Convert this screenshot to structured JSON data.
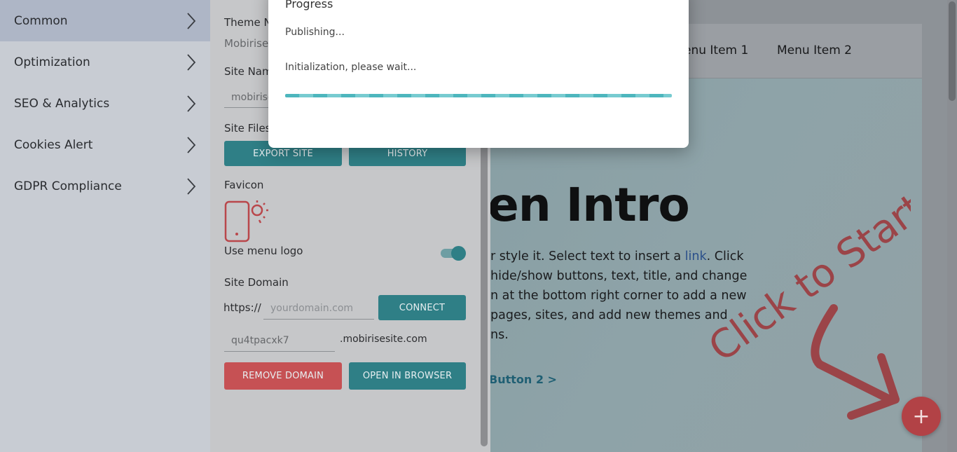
{
  "sidebar": {
    "items": [
      {
        "label": "Common",
        "active": true
      },
      {
        "label": "Optimization"
      },
      {
        "label": "SEO & Analytics"
      },
      {
        "label": "Cookies Alert"
      },
      {
        "label": "GDPR Compliance"
      }
    ]
  },
  "panel": {
    "theme_name_label": "Theme N",
    "theme_name_value": "Mobirise",
    "site_name_label": "Site Nam",
    "site_name_value": "mobirise",
    "site_files_label": "Site Files",
    "export_label": "EXPORT SITE",
    "history_label": "HISTORY",
    "favicon_label": "Favicon",
    "use_menu_logo_label": "Use menu logo",
    "use_menu_logo_on": true,
    "site_domain_label": "Site Domain",
    "domain_prefix": "https://",
    "domain_placeholder": "yourdomain.com",
    "connect_label": "CONNECT",
    "subdomain_value": "qu4tpacxk7",
    "subdomain_suffix": ".mobirisesite.com",
    "remove_domain_label": "REMOVE DOMAIN",
    "open_browser_label": "OPEN IN BROWSER"
  },
  "preview": {
    "nav": {
      "item1": "enu Item 1",
      "item2": "Menu Item 2"
    },
    "title": "en Intro",
    "lines": [
      {
        "before": "r style it. Select text to insert a ",
        "link": "link",
        "after": ". Click"
      },
      {
        "text": "hide/show buttons, text, title, and change"
      },
      {
        "text": "n at the bottom right corner to add a new"
      },
      {
        "text": "pages, sites, and add new themes and"
      },
      {
        "text": "ns."
      }
    ],
    "button2": "Button 2 >",
    "click_to_start": "Click to Start",
    "fab_icon": "+"
  },
  "modal": {
    "title": "Progress",
    "status": "Publishing...",
    "detail": "Initialization, please wait..."
  },
  "colors": {
    "accent_teal": "#2f7f86",
    "danger_red": "#c65154",
    "progress": "#4db6bd",
    "fab_red": "#b24246"
  }
}
